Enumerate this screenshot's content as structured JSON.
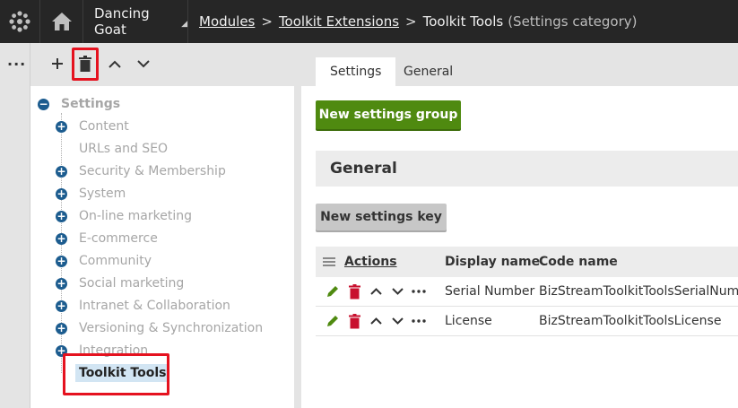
{
  "header": {
    "site_name": "Dancing Goat",
    "breadcrumbs": [
      "Modules",
      "Toolkit Extensions",
      "Toolkit Tools"
    ],
    "breadcrumb_suffix": "(Settings category)"
  },
  "left_strip": {
    "menu_label": "···"
  },
  "tree": {
    "root": "Settings",
    "items": [
      {
        "label": "Content",
        "expandable": true
      },
      {
        "label": "URLs and SEO",
        "expandable": false
      },
      {
        "label": "Security & Membership",
        "expandable": true
      },
      {
        "label": "System",
        "expandable": true
      },
      {
        "label": "On-line marketing",
        "expandable": true
      },
      {
        "label": "E-commerce",
        "expandable": true
      },
      {
        "label": "Community",
        "expandable": true
      },
      {
        "label": "Social marketing",
        "expandable": true
      },
      {
        "label": "Intranet & Collaboration",
        "expandable": true
      },
      {
        "label": "Versioning & Synchronization",
        "expandable": true
      },
      {
        "label": "Integration",
        "expandable": true
      }
    ],
    "selected": "Toolkit Tools"
  },
  "tabs": [
    "Settings",
    "General"
  ],
  "buttons": {
    "new_group": "New settings group",
    "new_key": "New settings key"
  },
  "group_title": "General",
  "table": {
    "headers": {
      "actions": "Actions",
      "display": "Display name",
      "code": "Code name"
    },
    "rows": [
      {
        "display": "Serial Number",
        "code": "BizStreamToolkitToolsSerialNumber"
      },
      {
        "display": "License",
        "code": "BizStreamToolkitToolsLicense"
      }
    ]
  },
  "colors": {
    "topbar": "#262626",
    "green_button": "#4f8a10",
    "highlight_box": "#e5121f",
    "tree_icon": "#1c5c8f",
    "edit_icon": "#4f8a10",
    "delete_icon": "#c8102e"
  }
}
